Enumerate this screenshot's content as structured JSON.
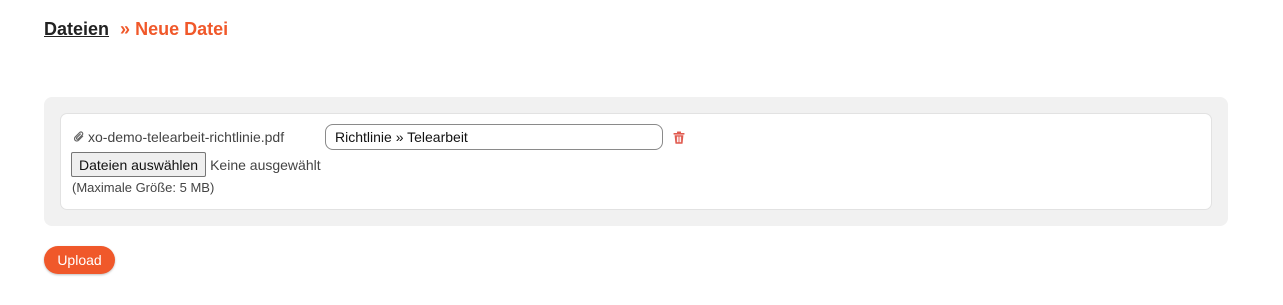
{
  "breadcrumb": {
    "parent": "Dateien",
    "separator": "»",
    "current": "Neue Datei"
  },
  "file_entry": {
    "attachment_icon": "paperclip-icon",
    "filename": "xo-demo-telearbeit-richtlinie.pdf",
    "title_value": "Richtlinie » Telearbeit",
    "delete_icon": "trash-icon",
    "choose_button_label": "Dateien auswählen",
    "no_file_text": "Keine ausgewählt",
    "size_hint": "(Maximale Größe: 5 MB)"
  },
  "actions": {
    "upload_label": "Upload"
  },
  "colors": {
    "accent": "#f0582a",
    "delete": "#e05a4f",
    "panel_background": "#f1f1f1"
  }
}
